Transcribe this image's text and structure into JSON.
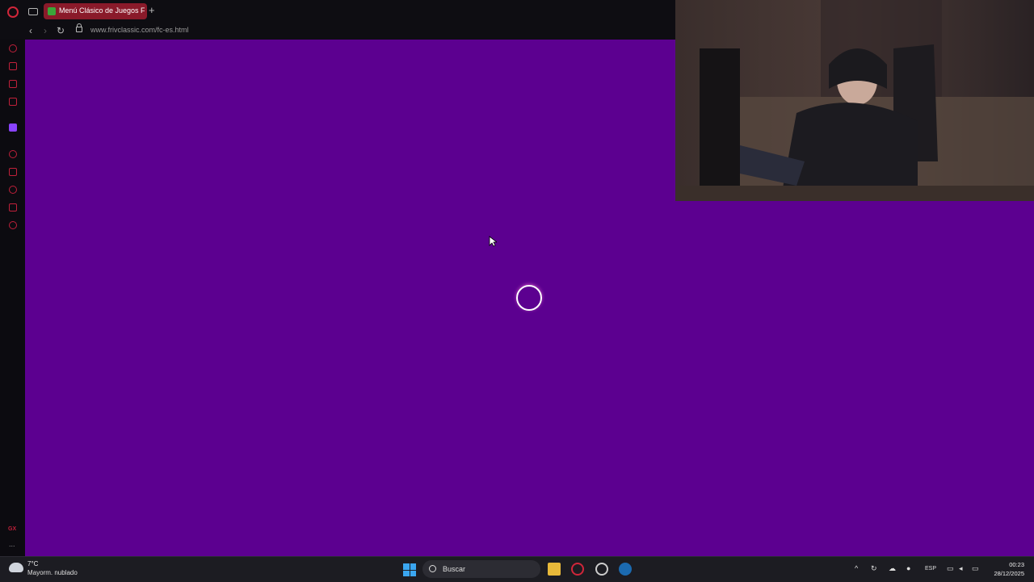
{
  "browser": {
    "tab": {
      "title": "Menú Clásico de Juegos F"
    },
    "new_tab_glyph": "+",
    "address": {
      "url": "www.frivclassic.com/fc-es.html"
    },
    "nav": {
      "back": "‹",
      "forward": "›",
      "reload": "↻"
    },
    "sidebar": {
      "icons": [
        "opera-logo-icon",
        "aria-icon",
        "messenger-icon",
        "whatsapp-icon",
        "music-icon",
        "twitch-icon",
        "player-icon",
        "pinboard-icon",
        "history-icon",
        "extensions-icon",
        "settings-icon"
      ],
      "gx_label": "GX",
      "more_glyph": "..."
    }
  },
  "page": {
    "background": "#5c0090",
    "state": "loading"
  },
  "colors": {
    "accent": "#c0203a",
    "tab_active": "#8a1a2a",
    "page_bg": "#5c0090"
  },
  "taskbar": {
    "weather": {
      "temp": "7°C",
      "condition": "Mayorm. nublado"
    },
    "search": {
      "placeholder": "Buscar"
    },
    "apps": [
      "windows-start-icon",
      "file-explorer-icon",
      "opera-gx-icon",
      "ea-app-icon",
      "steam-icon"
    ],
    "tray": {
      "language": "ESP"
    },
    "clock": {
      "time": "00:23",
      "date": "28/12/2025"
    }
  }
}
